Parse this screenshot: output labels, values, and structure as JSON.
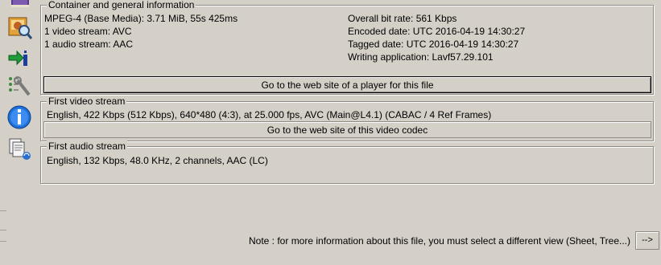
{
  "container": {
    "title": "Container and general information",
    "left_lines": [
      "MPEG-4 (Base Media): 3.71 MiB, 55s 425ms",
      "1 video stream: AVC",
      "1 audio stream: AAC"
    ],
    "right_lines": [
      "Overall bit rate: 561 Kbps",
      "Encoded date: UTC 2016-04-19 14:30:27",
      "Tagged date: UTC 2016-04-19 14:30:27",
      "Writing application: Lavf57.29.101"
    ],
    "button_label": "Go to the web site of a player for this file"
  },
  "video": {
    "title": "First video stream",
    "line": "English, 422 Kbps (512 Kbps), 640*480 (4:3), at 25.000 fps, AVC (Main@L4.1) (CABAC / 4 Ref Frames)",
    "button_label": "Go to the web site of this video codec"
  },
  "audio": {
    "title": "First audio stream",
    "line": "English, 132 Kbps, 48.0 KHz, 2 channels, AAC (LC)"
  },
  "footer": {
    "note": "Note : for more information about this file, you must select a different view (Sheet, Tree...)",
    "more_button_label": "-->"
  },
  "sidebar": {
    "icons": [
      "book-icon",
      "media-info-icon",
      "import-info-icon",
      "tools-icon",
      "info-icon",
      "documents-icon"
    ]
  }
}
